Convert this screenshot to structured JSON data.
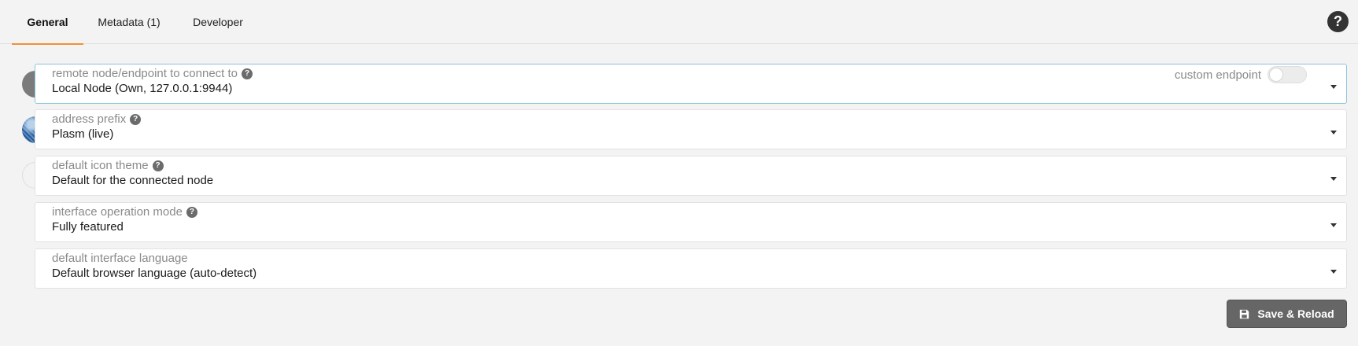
{
  "tabs": [
    {
      "label": "General"
    },
    {
      "label": "Metadata (1)"
    },
    {
      "label": "Developer"
    }
  ],
  "help_icon": "question-circle-icon",
  "rows": {
    "node": {
      "label": "remote node/endpoint to connect to",
      "value": "Local Node (Own, 127.0.0.1:9944)"
    },
    "prefix": {
      "label": "address prefix",
      "value": "Plasm (live)"
    },
    "theme": {
      "label": "default icon theme",
      "value": "Default for the connected node"
    },
    "mode": {
      "label": "interface operation mode",
      "value": "Fully featured"
    },
    "language": {
      "label": "default interface language",
      "value": "Default browser language (auto-detect)"
    }
  },
  "custom_endpoint": {
    "label": "custom endpoint",
    "enabled": false
  },
  "actions": {
    "save_reload": "Save & Reload"
  },
  "colors": {
    "accent": "#f19135",
    "focus_border": "#8cc4dd",
    "button_bg": "#666666"
  }
}
